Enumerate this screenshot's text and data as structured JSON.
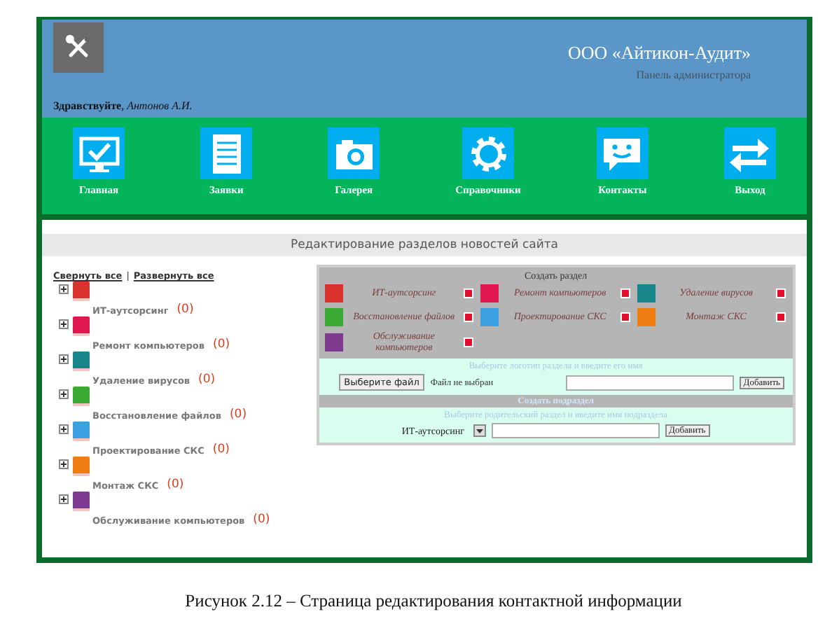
{
  "header": {
    "company": "ООО «Айтикон-Аудит»",
    "subtitle": "Панель администратора",
    "greeting": "**Здравствуйте**, *Антонов А.И.*"
  },
  "nav": [
    {
      "label": "Главная",
      "kind": "monitor"
    },
    {
      "label": "Заявки",
      "kind": "document"
    },
    {
      "label": "Галерея",
      "kind": "camera"
    },
    {
      "label": "Справочники",
      "kind": "gear"
    },
    {
      "label": "Контакты",
      "kind": "chat"
    },
    {
      "label": "Выход",
      "kind": "arrows"
    }
  ],
  "content_title": "Редактирование разделов новостей сайта",
  "tree": {
    "collapse_all": "Свернуть все",
    "separator": "|",
    "expand_all": "Развернуть все",
    "items": [
      {
        "name": "ИТ-аутсорсинг",
        "count": "(0)",
        "color": "#d9322c",
        "expanded": false
      },
      {
        "name": "Ремонт компьютеров",
        "count": "(0)",
        "color": "#e0174f",
        "expanded": false
      },
      {
        "name": "Удаление вирусов",
        "count": "(0)",
        "color": "#17858a",
        "expanded": false
      },
      {
        "name": "Восстановление файлов",
        "count": "(0)",
        "color": "#3aaa35",
        "expanded": false
      },
      {
        "name": "Проектирование СКС",
        "count": "(0)",
        "color": "#3c9fe0",
        "expanded": false
      },
      {
        "name": "Монтаж СКС",
        "count": "(0)",
        "color": "#f07d12",
        "expanded": false
      },
      {
        "name": "Обслуживание компьютеров",
        "count": "(0)",
        "color": "#7d3a8f",
        "expanded": false
      }
    ]
  },
  "panel": {
    "title": "Создать раздел",
    "sections": [
      {
        "name": "ИТ-аутсорсинг",
        "color": "#d9322c"
      },
      {
        "name": "Ремонт компьютеров",
        "color": "#e0174f"
      },
      {
        "name": "Удаление вирусов",
        "color": "#17858a"
      },
      {
        "name": "Восстановление файлов",
        "color": "#3aaa35"
      },
      {
        "name": "Проектирование СКС",
        "color": "#3c9fe0"
      },
      {
        "name": "Монтаж СКС",
        "color": "#f07d12"
      },
      {
        "name": "Обслуживание компьютеров",
        "color": "#7d3a8f"
      }
    ],
    "section_hint": "Выберите логотип раздела и введите его имя",
    "file_button": "Выберите файл",
    "file_status": "Файл не выбран",
    "add_button": "Добавить",
    "subsection_title": "Создать подраздел",
    "subsection_hint": "Выберите родительский раздел и введите имя подраздела",
    "parent_select": "ИТ-аутсорсинг",
    "subsection_add_button": "Добавить"
  },
  "caption": "Рисунок 2.12 – Страница редактирования контактной информации"
}
